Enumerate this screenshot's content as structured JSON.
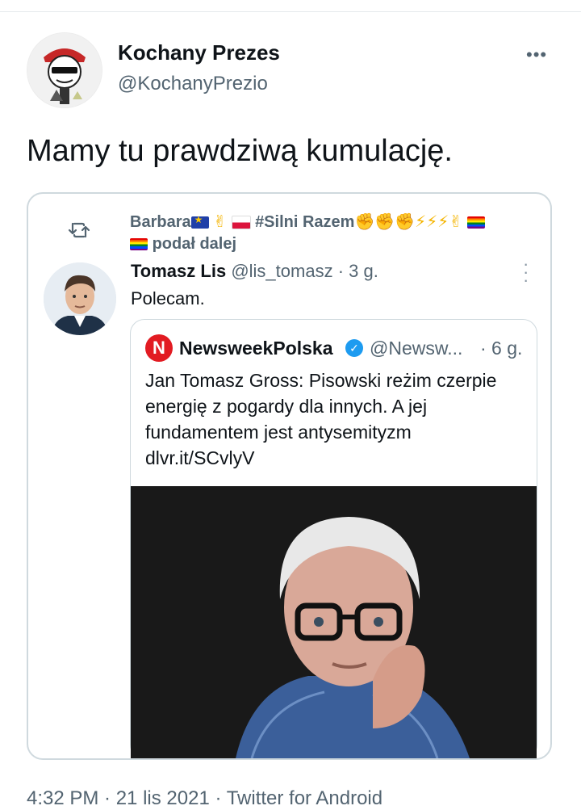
{
  "author": {
    "display_name": "Kochany Prezes",
    "handle": "@KochanyPrezio",
    "more_icon": "more-horizontal-icon"
  },
  "tweet": {
    "text": "Mamy tu prawdziwą kumulację."
  },
  "retweet_context": {
    "retweeter_name": "Barbara",
    "hashtag": "#Silni Razem",
    "action": "podał dalej",
    "icon": "retweet-icon"
  },
  "quoted_tweet": {
    "author_name": "Tomasz Lis",
    "handle": "@lis_tomasz",
    "separator": "·",
    "time": "3 g.",
    "text": "Polecam."
  },
  "nested_quote": {
    "logo_letter": "N",
    "author_name": "NewsweekPolska",
    "handle": "@Newsw...",
    "time": "· 6 g.",
    "text": "Jan Tomasz Gross: Pisowski reżim czerpie energię z pogardy dla innych. A jej fundamentem jest antysemityzm dlvr.it/SCvlyV",
    "verified": true
  },
  "footer": {
    "meta": "4:32 PM · 21 lis 2021 · Twitter for Android"
  }
}
